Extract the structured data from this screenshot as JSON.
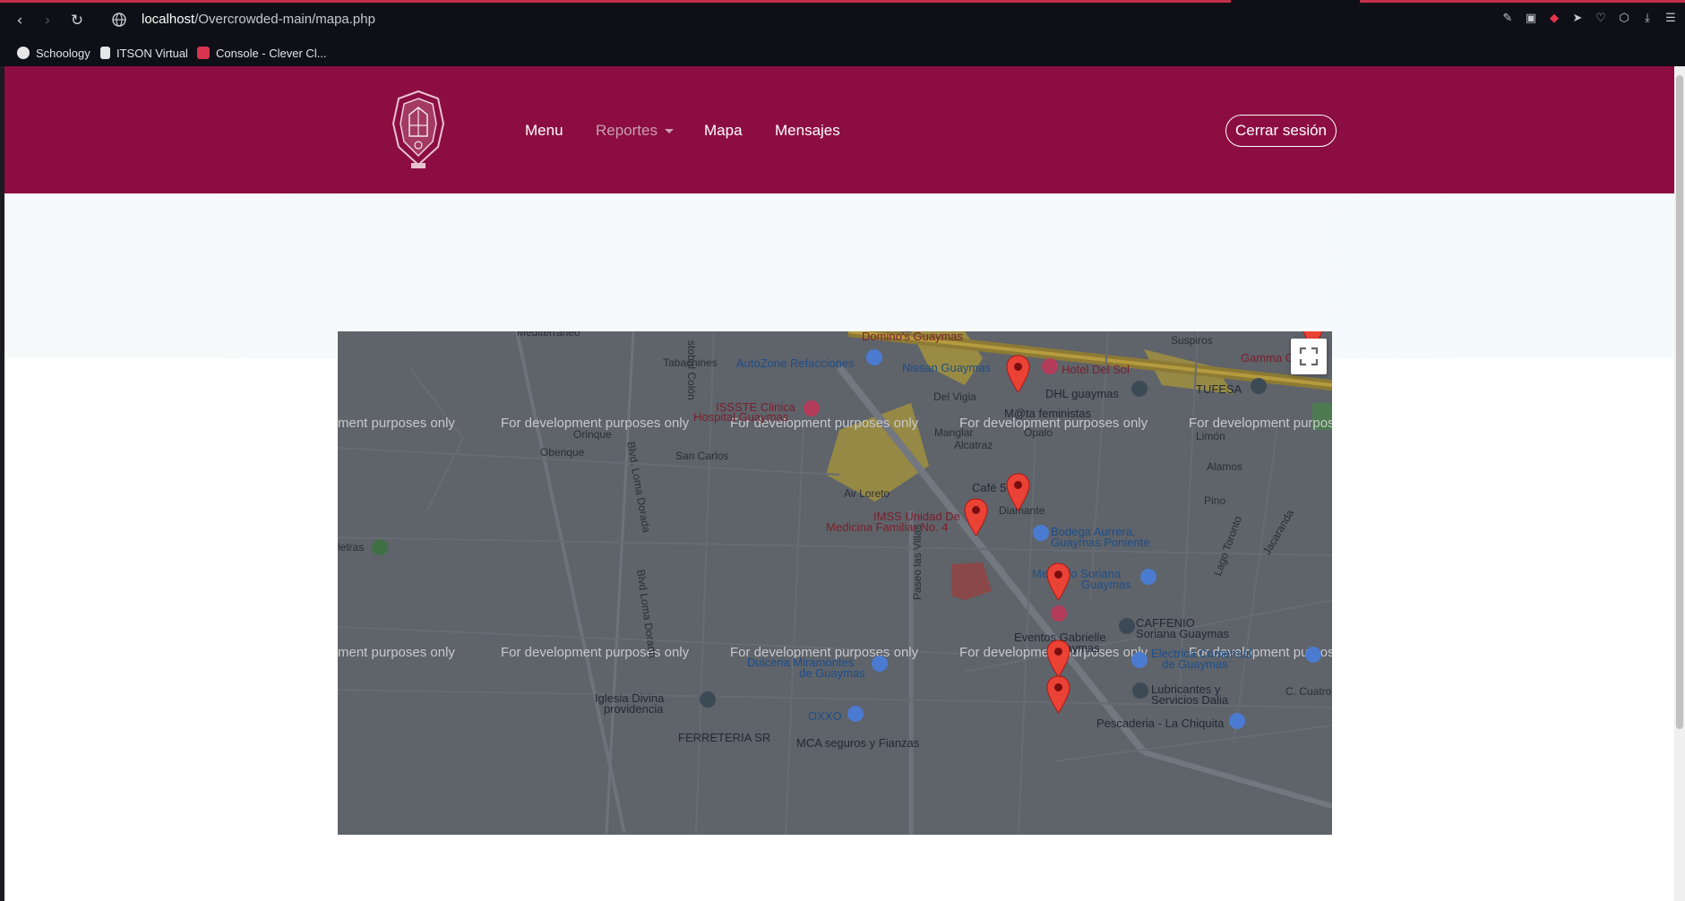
{
  "browser": {
    "url_host": "localhost",
    "url_path": "/Overcrowded-main/mapa.php",
    "bookmarks": [
      {
        "label": "Schoology",
        "color": "#e6e6ea"
      },
      {
        "label": "ITSON Virtual",
        "color": "#e6e6ea"
      },
      {
        "label": "Console - Clever Cl...",
        "color": "#d8344f"
      }
    ]
  },
  "navbar": {
    "bg_color": "#8c0d41",
    "links": {
      "menu": "Menu",
      "reportes": "Reportes",
      "mapa": "Mapa",
      "mensajes": "Mensajes"
    },
    "logout": "Cerrar sesión"
  },
  "map": {
    "watermark": "For development purposes only",
    "watermark_clipped": "ment purposes only",
    "watermark_tail": "For development purpose",
    "labels": {
      "dominos": "Domino's Guaymas",
      "autozone": "AutoZone Refacciones",
      "nissan": "Nissan Guaymas",
      "hotel": "Hotel Del Sol",
      "suspiros": "Suspiros",
      "gamma": "Gamma G",
      "tabachines": "Tabachines",
      "colon": "stobal Colón",
      "mediterraneo": "Mediterraneo",
      "del_vigia": "Del Vigia",
      "dhl": "DHL guaymas",
      "tufesa": "TUFESA",
      "issste": "ISSSTE Clinica",
      "hospital": "Hospital Guaymas",
      "manglar": "Manglar",
      "alcatraz": "Alcatraz",
      "matafeministas": "M@ta feministas",
      "opalo": "Opalo",
      "limon": "Limón",
      "orinque": "Orinque",
      "obenque": "Obenque",
      "san_carlos": "San Carlos",
      "alamos": "Alamos",
      "cafe": "Café 5",
      "diamante": "Diamante",
      "av_loreto": "Av Loreto",
      "imss": "IMSS Unidad De",
      "imss2": "Medicina Familiar No. 4",
      "pino": "Pino",
      "bodega": "Bodega Aurrera,",
      "bodega2": "Guaymas Poniente",
      "soriana_mercado": "Mercado Soriana",
      "soriana_mercado2": "Guaymas",
      "caffenio": "CAFFENIO",
      "caffenio2": "Soriana Guaymas",
      "eventos": "Eventos Gabrielle",
      "eventos2": "Guaymas",
      "electrica": "Electrica Comercial",
      "electrica2": "de Guaymas",
      "dulceria": "Dulceria Miramontes",
      "dulceria2": "de Guaymas",
      "iglesia": "Iglesia Divina",
      "iglesia2": "providencia",
      "lubricantes": "Lubricantes y",
      "lubricantes2": "Servicios Dalia",
      "oxxo": "OXXO",
      "pescaderia": "Pescaderia - La Chiquita",
      "ferreteria": "FERRETERIA SR",
      "mca": "MCA seguros y Fianzas",
      "paseo": "Paseo las Villas",
      "blvd_loma": "Blvd. Loma Dorada",
      "blvd_loma2": "Blvd Loma Dorada",
      "letras": "letras",
      "c_cuatro": "C. Cuatro",
      "lago_toronto": "Lago Toronto",
      "jacaranda": "Jacaranda"
    }
  }
}
